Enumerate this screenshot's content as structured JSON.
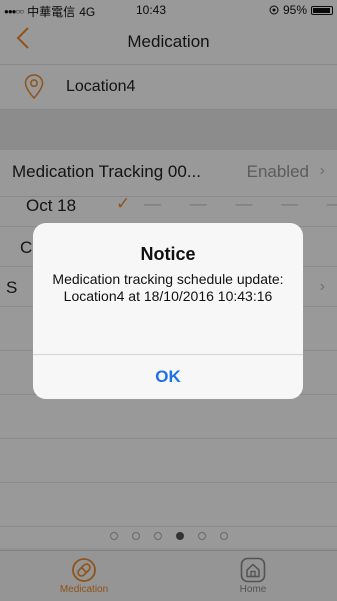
{
  "status_bar": {
    "carrier": "中華電信",
    "network": "4G",
    "time": "10:43",
    "battery": "95%"
  },
  "nav": {
    "back_icon": "chevron-left-icon",
    "title": "Medication"
  },
  "location": {
    "icon": "map-pin-icon",
    "name": "Location4"
  },
  "list": {
    "tracking_row": {
      "label": "Medication Tracking 00...",
      "value": "Enabled",
      "chevron": "›"
    },
    "date_row": {
      "label": "Oct 18",
      "check": "✓",
      "dashes": "— — — — — —"
    },
    "row3_partial": "C",
    "row4_partial": "S",
    "row4_chevron": "›"
  },
  "page_dots": {
    "count": 6,
    "active_index": 3
  },
  "tabs": [
    {
      "label": "Medication",
      "icon": "pill-icon",
      "active": true
    },
    {
      "label": "Home",
      "icon": "home-icon",
      "active": false
    }
  ],
  "alert": {
    "title": "Notice",
    "message": "Medication tracking schedule update: Location4 at 18/10/2016 10:43:16",
    "ok_label": "OK"
  },
  "colors": {
    "accent": "#f08a2c",
    "alert_button": "#1a73e8"
  }
}
